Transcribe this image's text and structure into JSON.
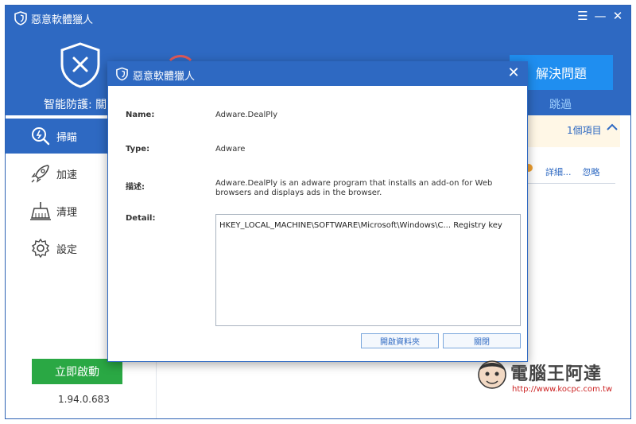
{
  "app": {
    "title": "惡意軟體獵人",
    "menu_icon": "menu-icon",
    "minimize_icon": "minimize-icon",
    "close_icon": "close-icon",
    "protection_label": "智能防護: 關",
    "solve_button": "解決問題",
    "skip_link": "跳過"
  },
  "sidebar": {
    "items": [
      {
        "label": "掃瞄",
        "icon": "scan-icon"
      },
      {
        "label": "加速",
        "icon": "rocket-icon"
      },
      {
        "label": "清理",
        "icon": "broom-icon"
      },
      {
        "label": "設定",
        "icon": "gear-icon"
      }
    ],
    "start_button": "立即啟動",
    "version": "1.94.0.683"
  },
  "results": {
    "count_label": "1個項目",
    "detail_link": "詳細...",
    "ignore_link": "忽略"
  },
  "dialog": {
    "title": "惡意軟體獵人",
    "fields": {
      "name_label": "Name:",
      "name_value": "Adware.DealPly",
      "type_label": "Type:",
      "type_value": "Adware",
      "desc_label": "描述:",
      "desc_value": "Adware.DealPly is an adware program that installs an add-on for Web browsers and displays ads in the browser.",
      "detail_label": "Detail:",
      "detail_value": "HKEY_LOCAL_MACHINE\\SOFTWARE\\Microsoft\\Windows\\C... Registry key"
    },
    "open_folder_button": "開啟資料夾",
    "close_button": "關閉"
  },
  "watermark": {
    "text": "電腦王阿達",
    "url": "http://www.kocpc.com.tw"
  },
  "colors": {
    "brand_blue": "#2e69c2",
    "accent_blue": "#1f8ef0",
    "start_green": "#2aa844"
  }
}
